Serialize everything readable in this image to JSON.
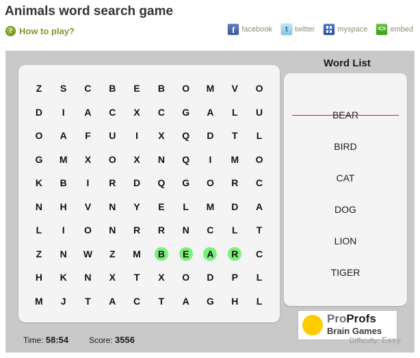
{
  "header": {
    "title": "Animals word search game",
    "howto_label": "How to play?",
    "help_icon": "question-mark-circle-icon"
  },
  "social": [
    {
      "label": "facebook",
      "icon": "facebook-icon",
      "glyph": "f"
    },
    {
      "label": "twitter",
      "icon": "twitter-icon",
      "glyph": "t"
    },
    {
      "label": "myspace",
      "icon": "myspace-icon",
      "glyph": ""
    },
    {
      "label": "embed",
      "icon": "embed-code-icon",
      "glyph": "<>"
    }
  ],
  "grid": {
    "rows": 10,
    "cols": 10,
    "letters": [
      [
        "Z",
        "S",
        "C",
        "B",
        "E",
        "B",
        "O",
        "M",
        "V",
        "O"
      ],
      [
        "D",
        "I",
        "A",
        "C",
        "X",
        "C",
        "G",
        "A",
        "L",
        "U"
      ],
      [
        "O",
        "A",
        "F",
        "U",
        "I",
        "X",
        "Q",
        "D",
        "T",
        "L"
      ],
      [
        "G",
        "M",
        "X",
        "O",
        "X",
        "N",
        "Q",
        "I",
        "M",
        "O"
      ],
      [
        "K",
        "B",
        "I",
        "R",
        "D",
        "Q",
        "G",
        "O",
        "R",
        "C"
      ],
      [
        "N",
        "H",
        "V",
        "N",
        "Y",
        "E",
        "L",
        "M",
        "D",
        "A"
      ],
      [
        "L",
        "I",
        "O",
        "N",
        "R",
        "R",
        "N",
        "C",
        "L",
        "T"
      ],
      [
        "Z",
        "N",
        "W",
        "Z",
        "M",
        "B",
        "E",
        "A",
        "R",
        "C"
      ],
      [
        "H",
        "K",
        "N",
        "X",
        "T",
        "X",
        "O",
        "D",
        "P",
        "L"
      ],
      [
        "M",
        "J",
        "T",
        "A",
        "C",
        "T",
        "A",
        "G",
        "H",
        "L"
      ]
    ],
    "found_cells": [
      [
        7,
        5
      ],
      [
        7,
        6
      ],
      [
        7,
        7
      ],
      [
        7,
        8
      ]
    ],
    "highlight_color": "#7bf07b"
  },
  "wordlist": {
    "title": "Word List",
    "words": [
      {
        "text": "BEAR",
        "found": true
      },
      {
        "text": "BIRD",
        "found": false
      },
      {
        "text": "CAT",
        "found": false
      },
      {
        "text": "DOG",
        "found": false
      },
      {
        "text": "LION",
        "found": false
      },
      {
        "text": "TIGER",
        "found": false
      }
    ],
    "strike_color": "#e01b1b"
  },
  "status": {
    "time_label": "Time:",
    "time_value": "58:54",
    "score_label": "Score:",
    "score_value": "3556",
    "difficulty_label": "Difficulty:",
    "difficulty_value": "Easy"
  },
  "logo": {
    "line1_pro": "Pro",
    "line1_profs": "Profs",
    "line2": "Brain Games",
    "dot_color": "#ffcc00"
  }
}
